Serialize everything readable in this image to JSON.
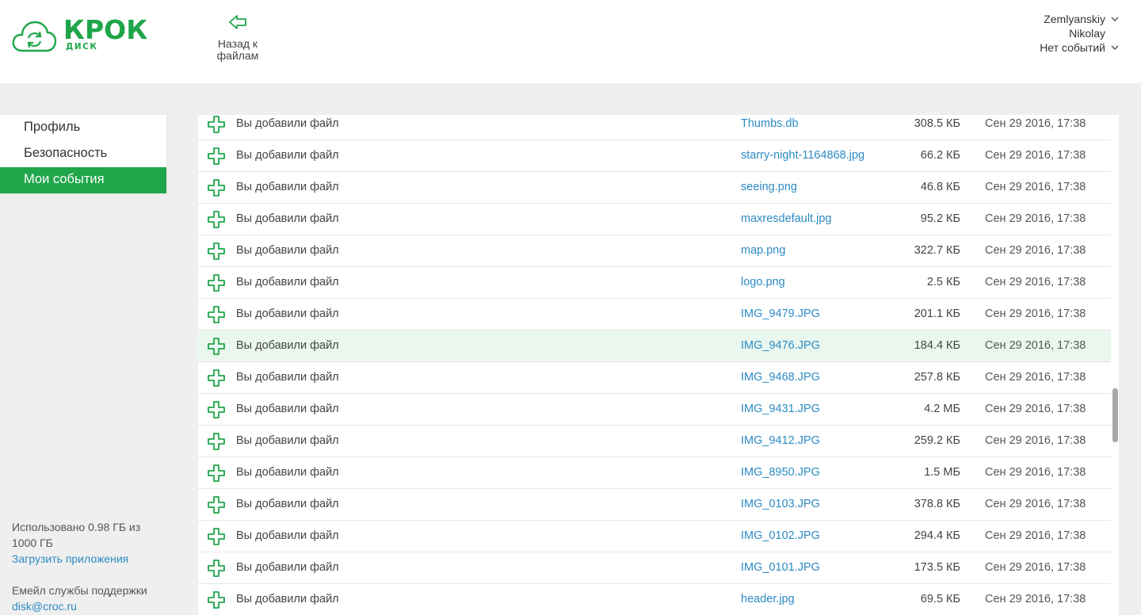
{
  "brand": {
    "name": "КРОК",
    "sub": "ДИСК",
    "color": "#1fa64a"
  },
  "header": {
    "back_label": "Назад к файлам",
    "user_first": "Zemlyanskiy",
    "user_last": "Nikolay",
    "events": "Нет событий"
  },
  "sidebar": {
    "items": [
      {
        "label": "Профиль",
        "active": false
      },
      {
        "label": "Безопасность",
        "active": false
      },
      {
        "label": "Мои события",
        "active": true
      }
    ],
    "usage": "Использовано 0.98 ГБ из 1000 ГБ",
    "download_apps": "Загрузить приложения",
    "support_label": "Емейл службы поддержки",
    "support_email": "disk@croc.ru"
  },
  "events": [
    {
      "action": "Вы добавили файл",
      "file": "Thumbs.db",
      "size": "308.5 КБ",
      "date": "Сен 29 2016, 17:38"
    },
    {
      "action": "Вы добавили файл",
      "file": "starry-night-1164868.jpg",
      "size": "66.2 КБ",
      "date": "Сен 29 2016, 17:38"
    },
    {
      "action": "Вы добавили файл",
      "file": "seeing.png",
      "size": "46.8 КБ",
      "date": "Сен 29 2016, 17:38"
    },
    {
      "action": "Вы добавили файл",
      "file": "maxresdefault.jpg",
      "size": "95.2 КБ",
      "date": "Сен 29 2016, 17:38"
    },
    {
      "action": "Вы добавили файл",
      "file": "map.png",
      "size": "322.7 КБ",
      "date": "Сен 29 2016, 17:38"
    },
    {
      "action": "Вы добавили файл",
      "file": "logo.png",
      "size": "2.5 КБ",
      "date": "Сен 29 2016, 17:38"
    },
    {
      "action": "Вы добавили файл",
      "file": "IMG_9479.JPG",
      "size": "201.1 КБ",
      "date": "Сен 29 2016, 17:38"
    },
    {
      "action": "Вы добавили файл",
      "file": "IMG_9476.JPG",
      "size": "184.4 КБ",
      "date": "Сен 29 2016, 17:38",
      "highlight": true
    },
    {
      "action": "Вы добавили файл",
      "file": "IMG_9468.JPG",
      "size": "257.8 КБ",
      "date": "Сен 29 2016, 17:38"
    },
    {
      "action": "Вы добавили файл",
      "file": "IMG_9431.JPG",
      "size": "4.2 МБ",
      "date": "Сен 29 2016, 17:38"
    },
    {
      "action": "Вы добавили файл",
      "file": "IMG_9412.JPG",
      "size": "259.2 КБ",
      "date": "Сен 29 2016, 17:38"
    },
    {
      "action": "Вы добавили файл",
      "file": "IMG_8950.JPG",
      "size": "1.5 МБ",
      "date": "Сен 29 2016, 17:38"
    },
    {
      "action": "Вы добавили файл",
      "file": "IMG_0103.JPG",
      "size": "378.8 КБ",
      "date": "Сен 29 2016, 17:38"
    },
    {
      "action": "Вы добавили файл",
      "file": "IMG_0102.JPG",
      "size": "294.4 КБ",
      "date": "Сен 29 2016, 17:38"
    },
    {
      "action": "Вы добавили файл",
      "file": "IMG_0101.JPG",
      "size": "173.5 КБ",
      "date": "Сен 29 2016, 17:38"
    },
    {
      "action": "Вы добавили файл",
      "file": "header.jpg",
      "size": "69.5 КБ",
      "date": "Сен 29 2016, 17:38"
    }
  ],
  "colors": {
    "accent": "#1fa64a",
    "link": "#2c8bc4",
    "highlight_row": "#eaf7ee"
  }
}
